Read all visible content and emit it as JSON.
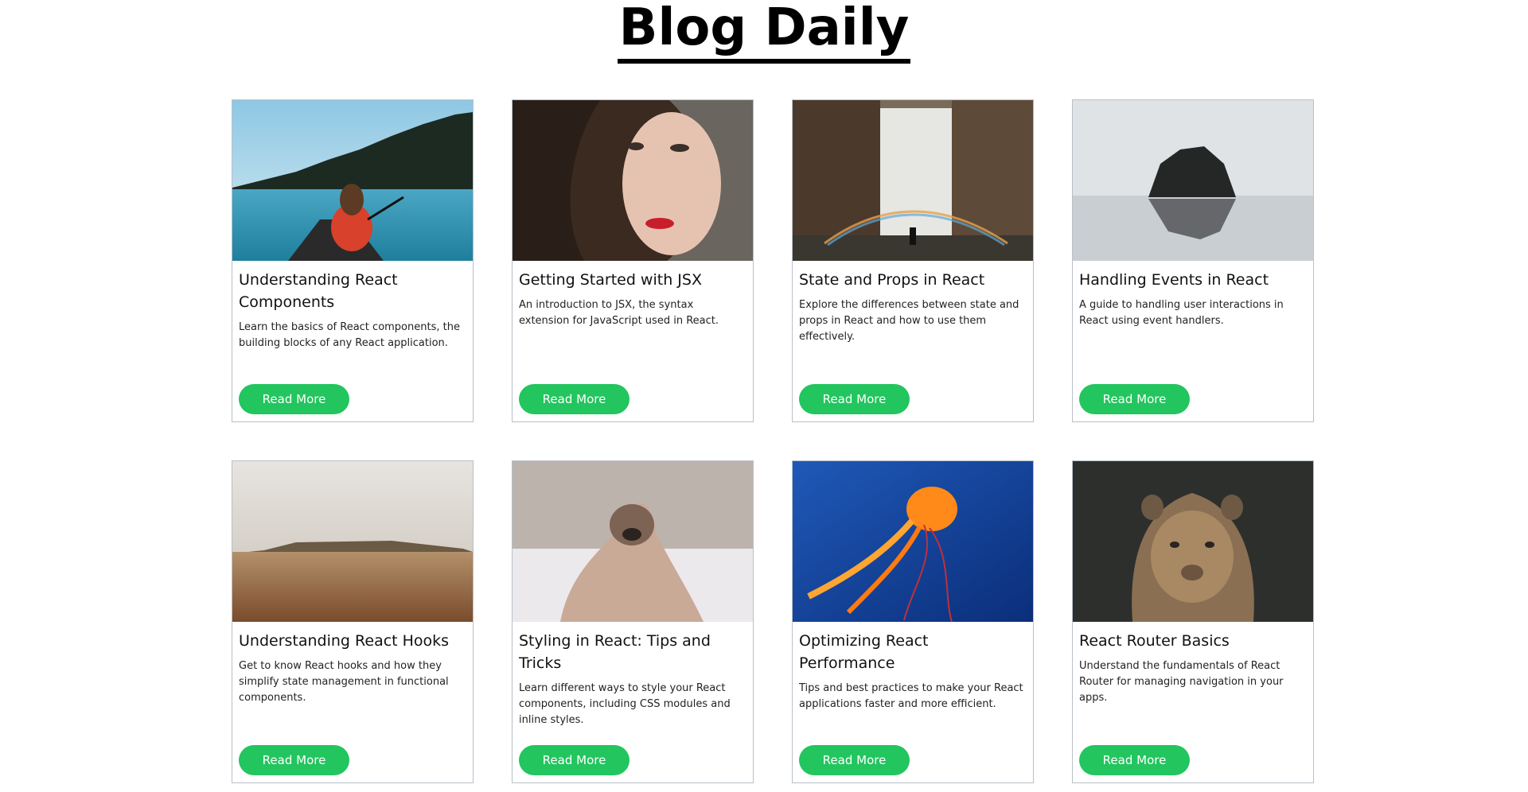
{
  "header": {
    "title": "Blog Daily"
  },
  "posts": [
    {
      "title": "Understanding React Components",
      "description": "Learn the basics of React components, the building blocks of any React application.",
      "button_label": "Read More"
    },
    {
      "title": "Getting Started with JSX",
      "description": "An introduction to JSX, the syntax extension for JavaScript used in React.",
      "button_label": "Read More"
    },
    {
      "title": "State and Props in React",
      "description": "Explore the differences between state and props in React and how to use them effectively.",
      "button_label": "Read More"
    },
    {
      "title": "Handling Events in React",
      "description": "A guide to handling user interactions in React using event handlers.",
      "button_label": "Read More"
    },
    {
      "title": "Understanding React Hooks",
      "description": "Get to know React hooks and how they simplify state management in functional components.",
      "button_label": "Read More"
    },
    {
      "title": "Styling in React: Tips and Tricks",
      "description": "Learn different ways to style your React components, including CSS modules and inline styles.",
      "button_label": "Read More"
    },
    {
      "title": "Optimizing React Performance",
      "description": "Tips and best practices to make your React applications faster and more efficient.",
      "button_label": "Read More"
    },
    {
      "title": "React Router Basics",
      "description": "Understand the fundamentals of React Router for managing navigation in your apps.",
      "button_label": "Read More"
    }
  ],
  "colors": {
    "button": "#22c55e",
    "card_border": "#b8c0c8"
  }
}
